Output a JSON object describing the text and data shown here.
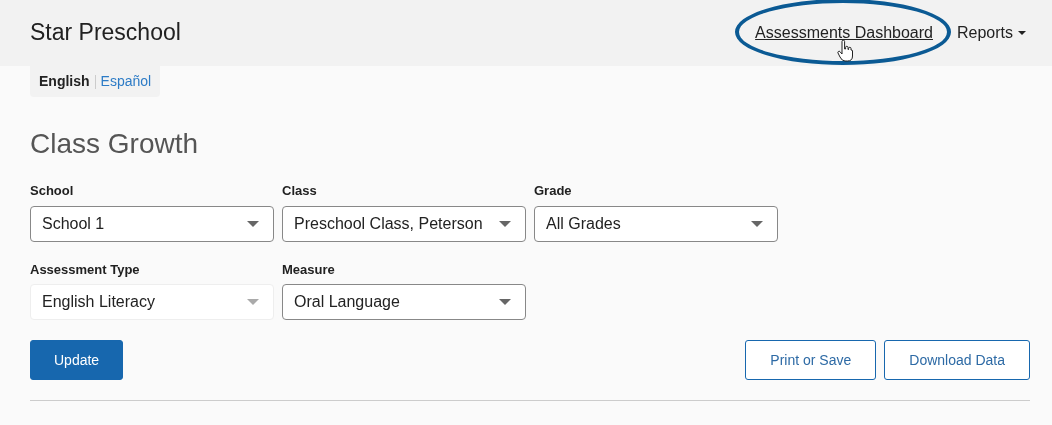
{
  "header": {
    "title": "Star Preschool",
    "nav": [
      {
        "label": "Assessments Dashboard",
        "kind": "link",
        "highlighted": true
      },
      {
        "label": "Reports",
        "kind": "dropdown",
        "highlighted": false
      }
    ]
  },
  "languages": [
    {
      "label": "English",
      "selected": true
    },
    {
      "label": "Español",
      "selected": false
    }
  ],
  "page_title": "Class Growth",
  "filter_rows": [
    [
      {
        "label": "School",
        "value": "School 1",
        "disabled": false
      },
      {
        "label": "Class",
        "value": "Preschool Class, Peterson",
        "disabled": false
      },
      {
        "label": "Grade",
        "value": "All Grades",
        "disabled": false
      }
    ],
    [
      {
        "label": "Assessment Type",
        "value": "English Literacy",
        "disabled": true
      },
      {
        "label": "Measure",
        "value": "Oral Language",
        "disabled": false
      }
    ]
  ],
  "buttons": [
    {
      "label": "Update",
      "kind": "primary"
    },
    {
      "label": "Print or Save",
      "kind": "outline"
    },
    {
      "label": "Download Data",
      "kind": "outline"
    }
  ]
}
